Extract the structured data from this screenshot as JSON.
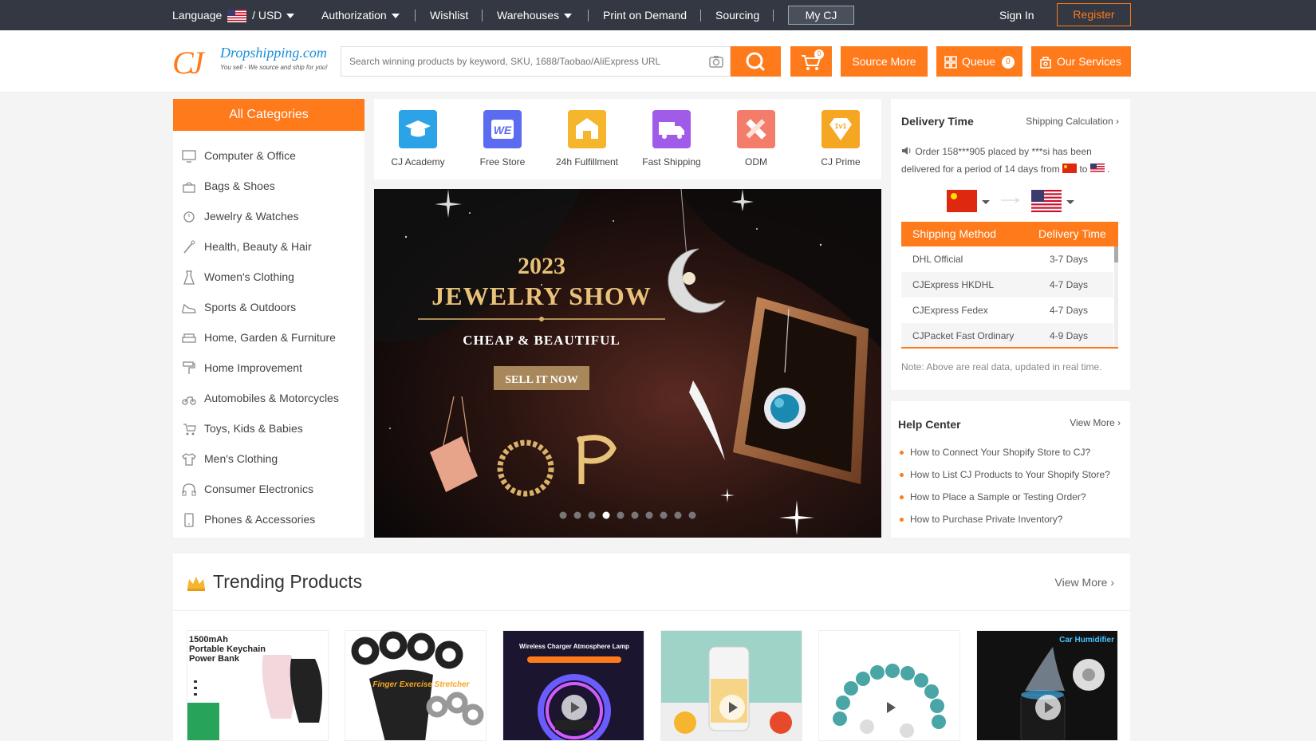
{
  "topbar": {
    "language": "Language",
    "currency": "USD",
    "authorization": "Authorization",
    "wishlist": "Wishlist",
    "warehouses": "Warehouses",
    "print_on_demand": "Print on Demand",
    "sourcing": "Sourcing",
    "my_cj": "My CJ",
    "sign_in": "Sign In",
    "register": "Register"
  },
  "header": {
    "logo_text": "Dropshipping.com",
    "logo_tagline": "You sell - We source and ship for you!",
    "search_placeholder": "Search winning products by keyword, SKU, 1688/Taobao/AliExpress URL",
    "cart_count": "0",
    "source_more": "Source More",
    "queue": "Queue",
    "queue_count": "0",
    "our_services": "Our Services"
  },
  "categories": {
    "title": "All Categories",
    "items": [
      {
        "label": "Computer & Office",
        "icon": "monitor-icon"
      },
      {
        "label": "Bags & Shoes",
        "icon": "bag-icon"
      },
      {
        "label": "Jewelry & Watches",
        "icon": "watch-icon"
      },
      {
        "label": "Health, Beauty & Hair",
        "icon": "brush-icon"
      },
      {
        "label": "Women's Clothing",
        "icon": "dress-icon"
      },
      {
        "label": "Sports & Outdoors",
        "icon": "shoe-icon"
      },
      {
        "label": "Home, Garden & Furniture",
        "icon": "sofa-icon"
      },
      {
        "label": "Home Improvement",
        "icon": "paint-roller-icon"
      },
      {
        "label": "Automobiles & Motorcycles",
        "icon": "motorcycle-icon"
      },
      {
        "label": "Toys, Kids & Babies",
        "icon": "stroller-icon"
      },
      {
        "label": "Men's Clothing",
        "icon": "shirt-icon"
      },
      {
        "label": "Consumer Electronics",
        "icon": "headphones-icon"
      },
      {
        "label": "Phones & Accessories",
        "icon": "phone-icon"
      }
    ]
  },
  "quick_links": [
    {
      "label": "CJ Academy",
      "icon": "graduation-cap-icon",
      "color": "#2ba3e6"
    },
    {
      "label": "Free Store",
      "icon": "we-store-icon",
      "color": "#5b6cf0"
    },
    {
      "label": "24h Fulfillment",
      "icon": "warehouse-icon",
      "color": "#f5b52c"
    },
    {
      "label": "Fast Shipping",
      "icon": "truck-icon",
      "color": "#a05ce8"
    },
    {
      "label": "ODM",
      "icon": "ruler-pencil-icon",
      "color": "#f47c6a"
    },
    {
      "label": "CJ Prime",
      "icon": "diamond-1v1-icon",
      "color": "#f5a623"
    }
  ],
  "banner": {
    "year": "2023",
    "title": "JEWELRY SHOW",
    "subtitle": "CHEAP & BEAUTIFUL",
    "cta": "SELL IT NOW",
    "slide_count": 10,
    "active_slide": 4
  },
  "delivery": {
    "title": "Delivery Time",
    "calc_link": "Shipping Calculation",
    "message_a": "Order 158***905 placed by ***si has been delivered for a period of 14 days from",
    "message_b": "to",
    "table_headers": [
      "Shipping Method",
      "Delivery Time"
    ],
    "rows": [
      {
        "method": "DHL Official",
        "time": "3-7 Days"
      },
      {
        "method": "CJExpress HKDHL",
        "time": "4-7 Days"
      },
      {
        "method": "CJExpress Fedex",
        "time": "4-7 Days"
      },
      {
        "method": "CJPacket Fast Ordinary",
        "time": "4-9 Days"
      }
    ],
    "note": "Note: Above are real data, updated in real time."
  },
  "help": {
    "title": "Help Center",
    "view_more": "View More",
    "links": [
      "How to Connect Your Shopify Store to CJ?",
      "How to List CJ Products to Your Shopify Store?",
      "How to Place a Sample or Testing Order?",
      "How to Purchase Private Inventory?"
    ]
  },
  "trending": {
    "title": "Trending Products",
    "view_more": "View More",
    "products": [
      {
        "caption_1": "1500mAh",
        "caption_2": "Portable Keychain",
        "caption_3": "Power Bank"
      },
      {
        "caption_1": "Finger Exercise Stretcher"
      },
      {
        "caption_1": "Wireless Charger Atmosphere Lamp"
      },
      {
        "caption_1": ""
      },
      {
        "caption_1": ""
      },
      {
        "caption_1": "Car Humidifier"
      }
    ]
  },
  "colors": {
    "accent": "#ff7a1a",
    "topbar": "#333842"
  }
}
